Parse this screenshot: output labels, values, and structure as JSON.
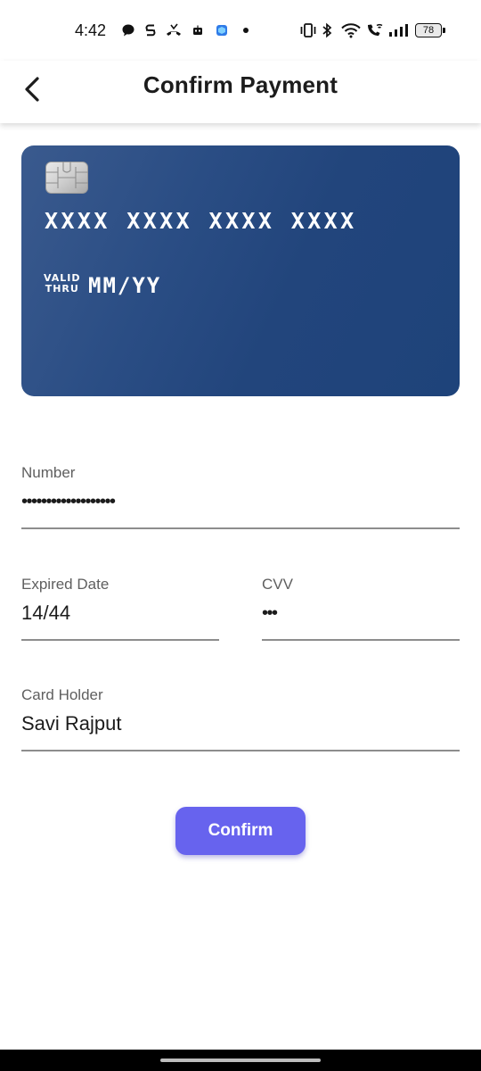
{
  "status_bar": {
    "time": "4:42",
    "battery": "78",
    "icons": [
      "chat-bubble-icon",
      "s-circle-icon",
      "missed-call-icon",
      "robot-icon",
      "app-cube-icon",
      "dot-icon",
      "vibrate-icon",
      "bluetooth-icon",
      "wifi-icon",
      "wifi-calling-icon",
      "signal-icon",
      "battery-icon"
    ]
  },
  "header": {
    "title": "Confirm Payment",
    "back_icon": "chevron-left-icon"
  },
  "card": {
    "number_mask": "XXXX XXXX XXXX XXXX",
    "valid_line1": "VALID",
    "valid_line2": "THRU",
    "expiry_mask": "MM/YY",
    "gradient_start": "#3a5a8e",
    "gradient_end": "#1e437a",
    "chip_icon": "card-chip-icon"
  },
  "form": {
    "number": {
      "label": "Number",
      "value": "•••••••••••••••••••"
    },
    "expired_date": {
      "label": "Expired Date",
      "value": "14/44"
    },
    "cvv": {
      "label": "CVV",
      "value": "•••"
    },
    "card_holder": {
      "label": "Card Holder",
      "value": "Savi Rajput"
    }
  },
  "actions": {
    "confirm_label": "Confirm",
    "confirm_color": "#6763ee"
  }
}
